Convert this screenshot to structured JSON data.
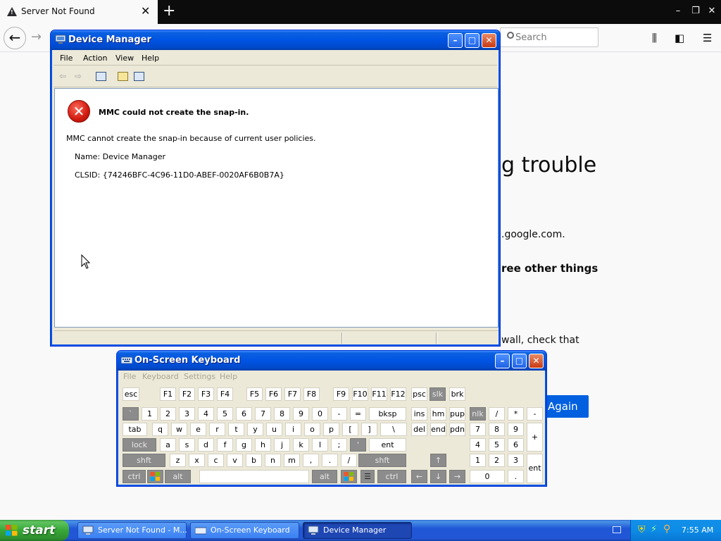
{
  "firefox": {
    "tab_title": "Server Not Found",
    "tab_close": "✕",
    "new_tab": "+",
    "search_placeholder": "Search",
    "heading_partial": "g trouble",
    "line1_partial": ".google.com.",
    "line2_partial": "ree other things",
    "line3_partial": "wall, check that",
    "try_again_partial": "Again"
  },
  "device_manager": {
    "title": "Device Manager",
    "menu": [
      "File",
      "Action",
      "View",
      "Help"
    ],
    "error_title": "MMC could not create the snap-in.",
    "error_desc": "MMC cannot create the snap-in because of current user policies.",
    "name_line": "Name: Device Manager",
    "clsid_line": "CLSID: {74246BFC-4C96-11D0-ABEF-0020AF6B0B7A}"
  },
  "osk": {
    "title": "On-Screen Keyboard",
    "menu": [
      "File",
      "Keyboard",
      "Settings",
      "Help"
    ],
    "rows": {
      "fn": [
        "esc",
        "F1",
        "F2",
        "F3",
        "F4",
        "F5",
        "F6",
        "F7",
        "F8",
        "F9",
        "F10",
        "F11",
        "F12",
        "psc",
        "slk",
        "brk"
      ],
      "num": [
        "`",
        "1",
        "2",
        "3",
        "4",
        "5",
        "6",
        "7",
        "8",
        "9",
        "0",
        "-",
        "=",
        "bksp",
        "ins",
        "hm",
        "pup",
        "nlk",
        "/",
        "*",
        "-"
      ],
      "tab": [
        "tab",
        "q",
        "w",
        "e",
        "r",
        "t",
        "y",
        "u",
        "i",
        "o",
        "p",
        "[",
        "]",
        "\\",
        "del",
        "end",
        "pdn",
        "7",
        "8",
        "9",
        "+"
      ],
      "caps": [
        "lock",
        "a",
        "s",
        "d",
        "f",
        "g",
        "h",
        "j",
        "k",
        "l",
        ";",
        "'",
        "ent",
        "4",
        "5",
        "6"
      ],
      "shift": [
        "shft",
        "z",
        "x",
        "c",
        "v",
        "b",
        "n",
        "m",
        ",",
        ".",
        "/",
        "shft",
        "↑",
        "1",
        "2",
        "3",
        "ent"
      ],
      "bottom": [
        "ctrl",
        "alt",
        "alt",
        "ctrl",
        "←",
        "↓",
        "→",
        "0",
        "."
      ]
    }
  },
  "taskbar": {
    "start_label": "start",
    "tasks": [
      "Server Not Found - M...",
      "On-Screen Keyboard",
      "Device Manager"
    ],
    "clock": "7:55 AM"
  },
  "colors": {
    "xp_blue": "#0054e3",
    "firefox_blue": "#0060df",
    "key_dark": "#8c8c8c"
  }
}
